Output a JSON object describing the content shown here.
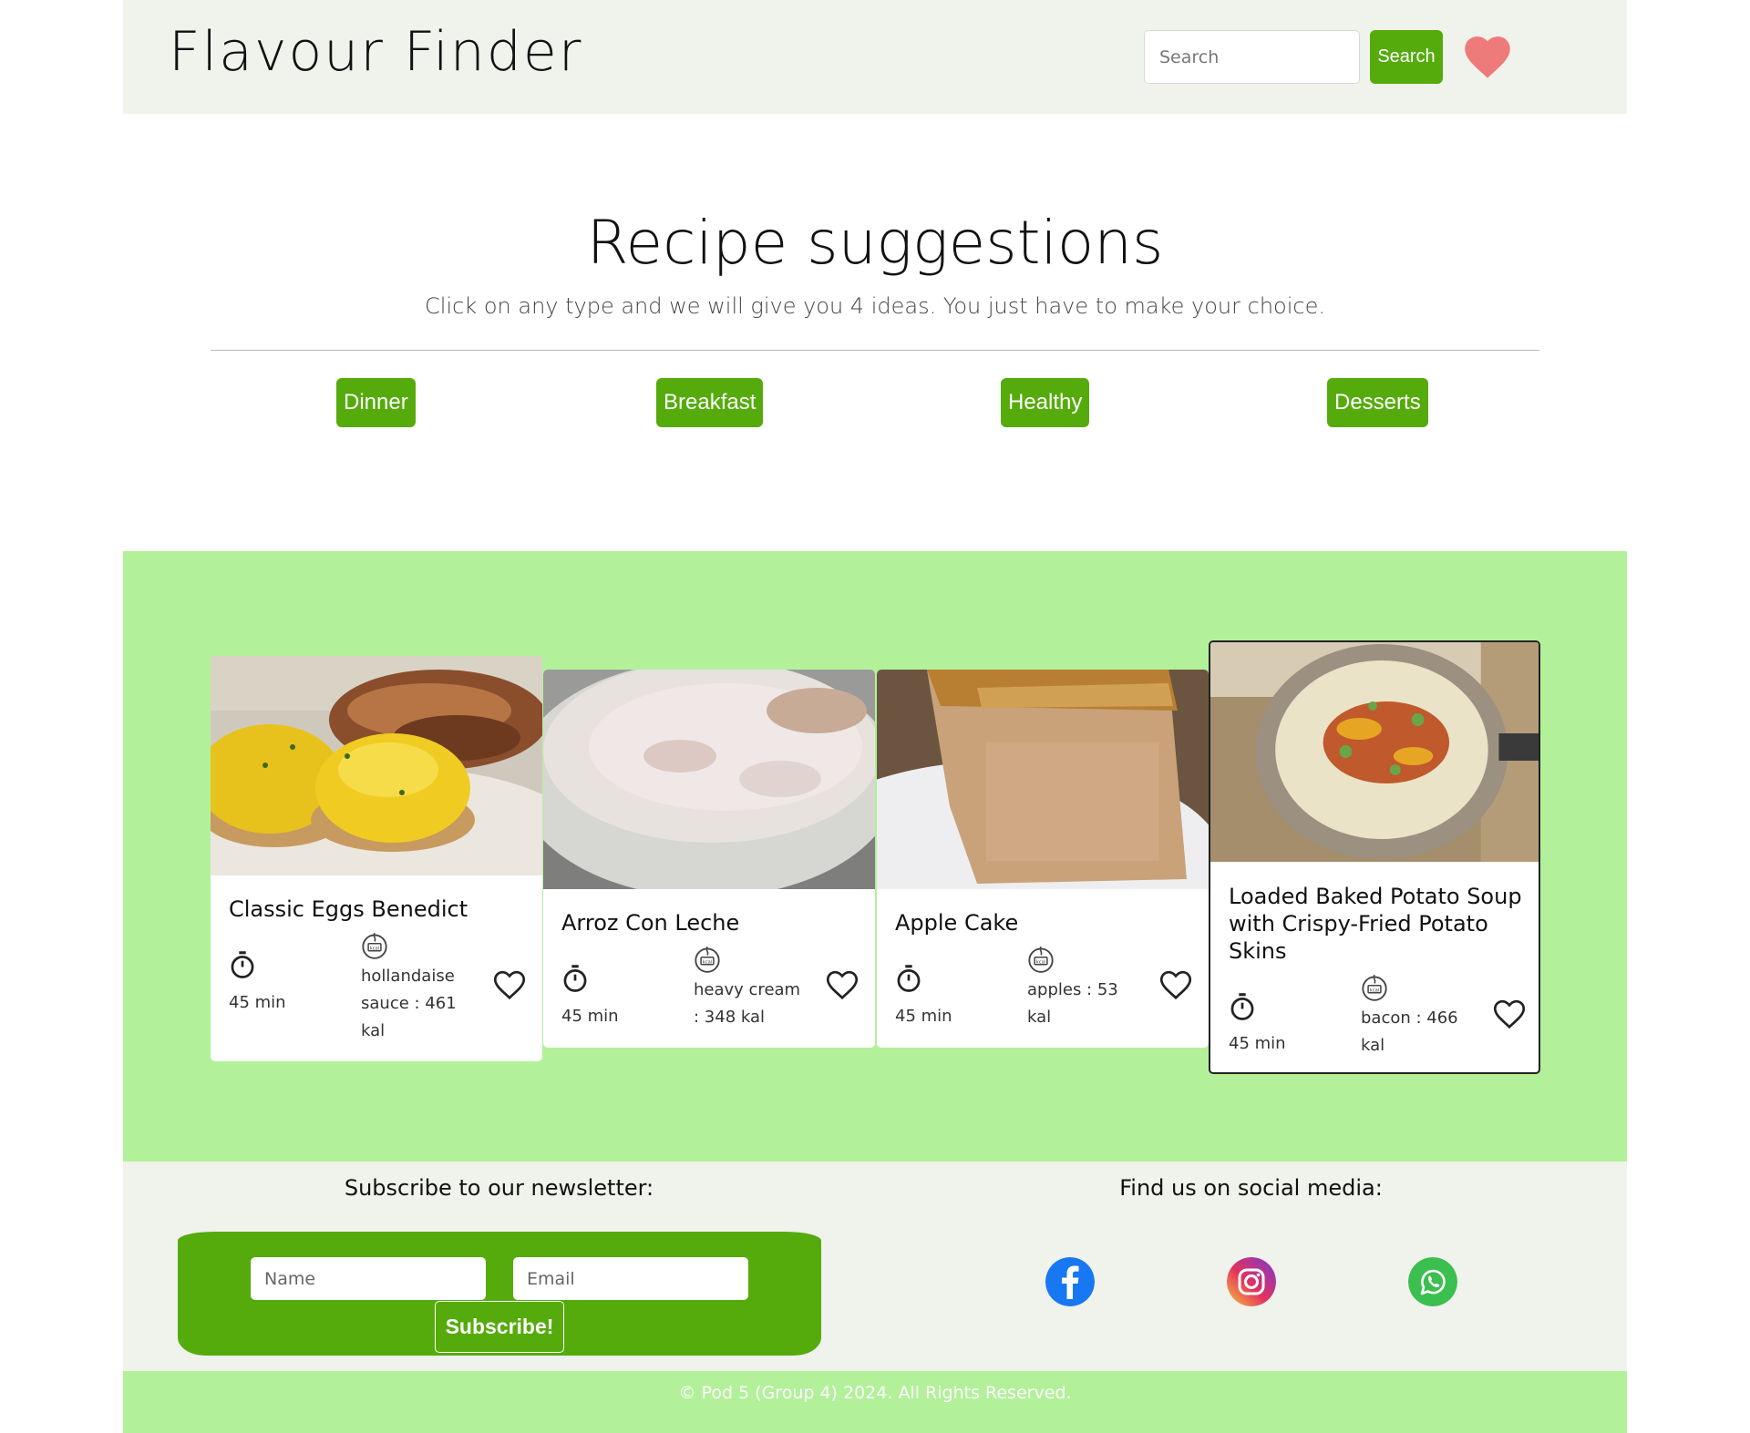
{
  "header": {
    "logo": "Flavour Finder",
    "search_placeholder": "Search",
    "search_button": "Search",
    "favorites_icon": "heart-icon",
    "accent_color": "#55ab0b"
  },
  "hero": {
    "title": "Recipe suggestions",
    "subtitle": "Click on any type and we will give you 4 ideas. You just have to make your choice."
  },
  "types": [
    "Dinner",
    "Breakfast",
    "Healthy",
    "Desserts"
  ],
  "recipes": [
    {
      "title": "Classic Eggs Benedict",
      "time": "45 min",
      "kcal": "hollandaise sauce : 461 kal",
      "image": "eggs-benedict-photo"
    },
    {
      "title": "Arroz Con Leche",
      "time": "45 min",
      "kcal": "heavy cream : 348 kal",
      "image": "rice-pudding-photo"
    },
    {
      "title": "Apple Cake",
      "time": "45 min",
      "kcal": "apples : 53 kal",
      "image": "apple-cake-photo"
    },
    {
      "title": "Loaded Baked Potato Soup with Crispy-Fried Potato Skins",
      "time": "45 min",
      "kcal": "bacon : 466 kal",
      "image": "potato-soup-photo"
    }
  ],
  "footer": {
    "newsletter_title": "Subscribe to our newsletter:",
    "name_placeholder": "Name",
    "email_placeholder": "Email",
    "subscribe_button": "Subscribe!",
    "social_title": "Find us on social media:",
    "social": [
      "facebook-icon",
      "instagram-icon",
      "whatsapp-icon"
    ],
    "copyright": "© Pod 5 (Group 4) 2024. All Rights Reserved."
  }
}
